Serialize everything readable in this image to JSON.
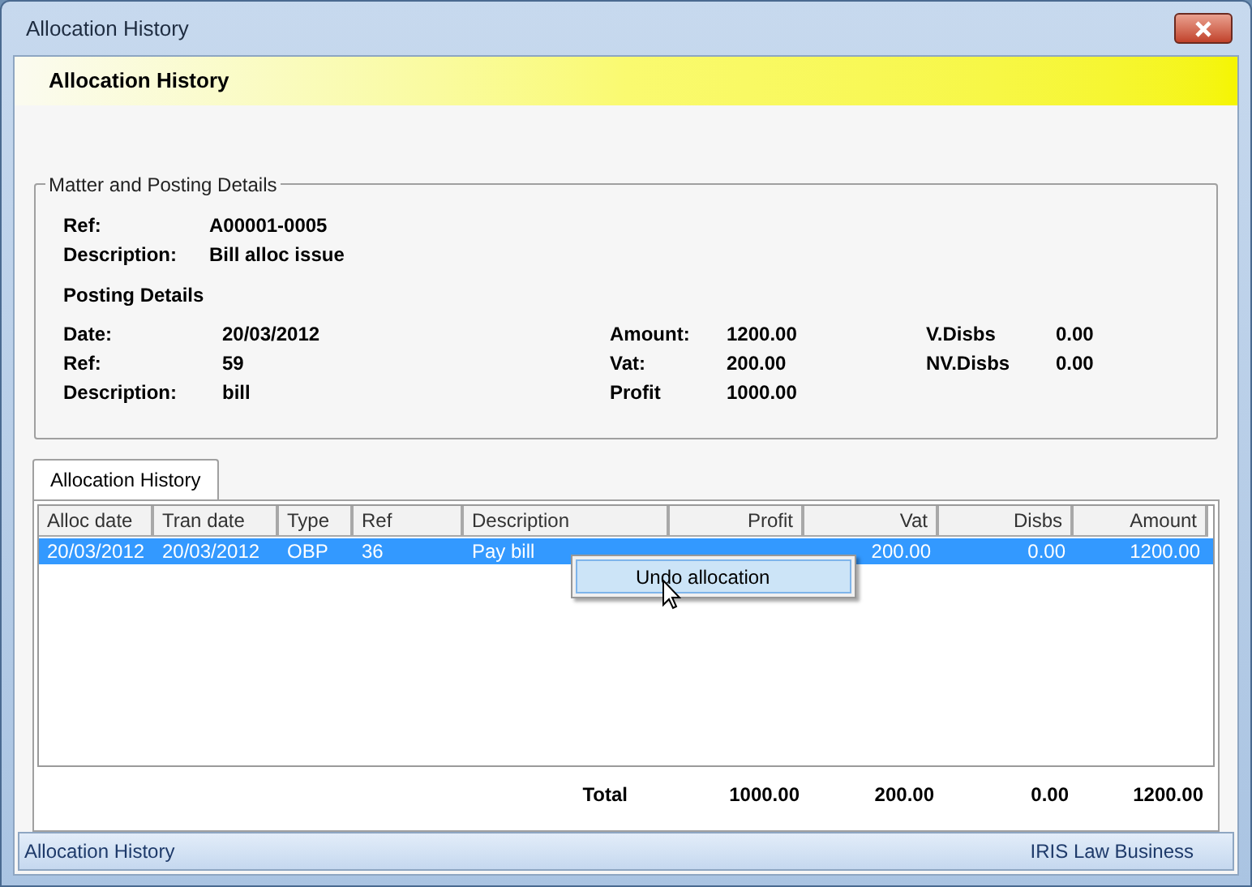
{
  "window": {
    "title": "Allocation History"
  },
  "header": "Allocation History",
  "matter_group": {
    "title": "Matter and Posting Details",
    "matter": [
      {
        "label": "Ref:",
        "value": "A00001-0005"
      },
      {
        "label": "Description:",
        "value": "Bill alloc issue"
      }
    ],
    "posting_title": "Posting Details",
    "posting_col1": [
      {
        "label": "Date:",
        "value": "20/03/2012"
      },
      {
        "label": "Ref:",
        "value": "59"
      },
      {
        "label": "Description:",
        "value": "bill"
      }
    ],
    "posting_col2": [
      {
        "label": "Amount:",
        "value": "1200.00"
      },
      {
        "label": "Vat:",
        "value": "200.00"
      },
      {
        "label": "Profit",
        "value": "1000.00"
      }
    ],
    "posting_col3": [
      {
        "label": "V.Disbs",
        "value": "0.00"
      },
      {
        "label": "NV.Disbs",
        "value": "0.00"
      }
    ]
  },
  "tabs": [
    {
      "label": "Allocation History",
      "selected": true
    }
  ],
  "table": {
    "columns": [
      "Alloc date",
      "Tran date",
      "Type",
      "Ref",
      "Description",
      "Profit",
      "Vat",
      "Disbs",
      "Amount"
    ],
    "rows": [
      {
        "selected": true,
        "cells": [
          "20/03/2012",
          "20/03/2012",
          "OBP",
          "36",
          "Pay bill",
          null,
          "200.00",
          "0.00",
          "1200.00"
        ]
      }
    ]
  },
  "context_menu": {
    "items": [
      "Undo allocation"
    ]
  },
  "totals": {
    "label": "Total",
    "values": [
      "1000.00",
      "200.00",
      "0.00",
      "1200.00"
    ]
  },
  "status_bar": {
    "left": "Allocation History",
    "right": "IRIS Law Business"
  }
}
